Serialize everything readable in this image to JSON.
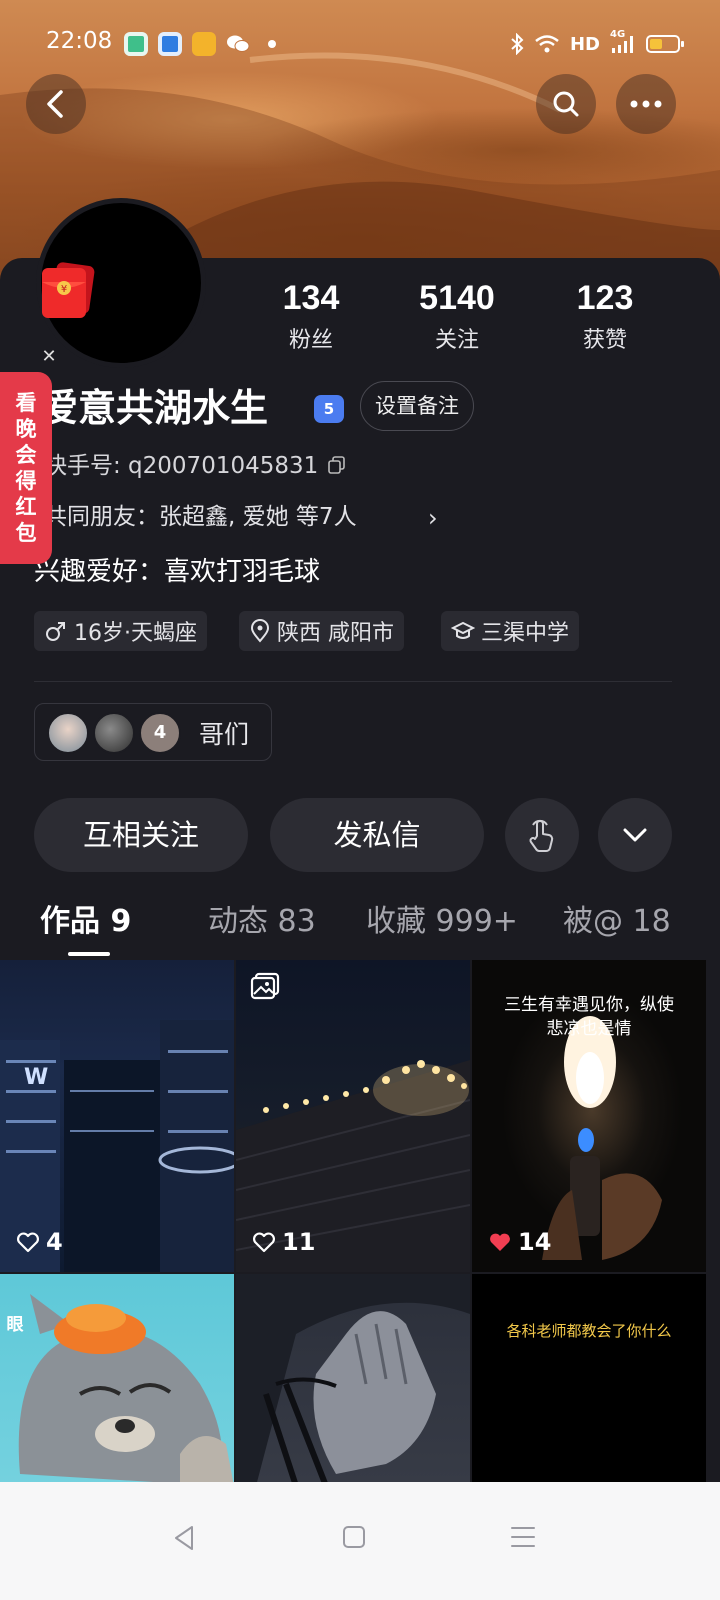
{
  "status_bar": {
    "time": "22:08",
    "network": "HD",
    "signal_label": "4G",
    "icons": [
      "app-green-icon",
      "app-blue-icon",
      "app-yellow-icon",
      "wechat-icon",
      "bluetooth-icon",
      "wifi-icon",
      "signal-icon",
      "battery-icon"
    ]
  },
  "header": {
    "back_icon": "back-arrow-icon",
    "search_icon": "search-icon",
    "more_icon": "more-dots-icon"
  },
  "side_banner": {
    "chars": [
      "看",
      "晚",
      "会",
      "得",
      "红",
      "包"
    ]
  },
  "profile": {
    "name": "爱意共湖水生",
    "level": "5",
    "remark_button": "设置备注",
    "kuaishou_id": "快手号: q200701045831",
    "mutual_friends": "共同朋友：张超鑫, 爱她 等7人",
    "bio": "兴趣爱好：喜欢打羽毛球",
    "tags": {
      "age": "16岁·天蝎座",
      "location": "陕西 咸阳市",
      "school": "三渠中学"
    },
    "group": {
      "extra_count": "4",
      "name": "哥们"
    }
  },
  "stats": {
    "fans": {
      "value": "134",
      "label": "粉丝"
    },
    "following": {
      "value": "5140",
      "label": "关注"
    },
    "likes": {
      "value": "123",
      "label": "获赞"
    }
  },
  "actions": {
    "follow": "互相关注",
    "message": "发私信"
  },
  "tabs": {
    "works": "作品 9",
    "moments": "动态 83",
    "favorites": "收藏 999+",
    "mentions": "被@ 18"
  },
  "posts": [
    {
      "likes": "4"
    },
    {
      "likes": "11"
    },
    {
      "likes": "14",
      "caption_line1": "三生有幸遇见你，纵使",
      "caption_line2": "悲凉也是情"
    },
    {
      "caption_side": "眼"
    },
    {},
    {
      "caption": "各科老师都教会了你什么"
    }
  ],
  "colors": {
    "background": "#1b1b21",
    "accent_red": "#e43a49",
    "badge_blue": "#4b7cf0",
    "heart_red": "#f23e52"
  }
}
